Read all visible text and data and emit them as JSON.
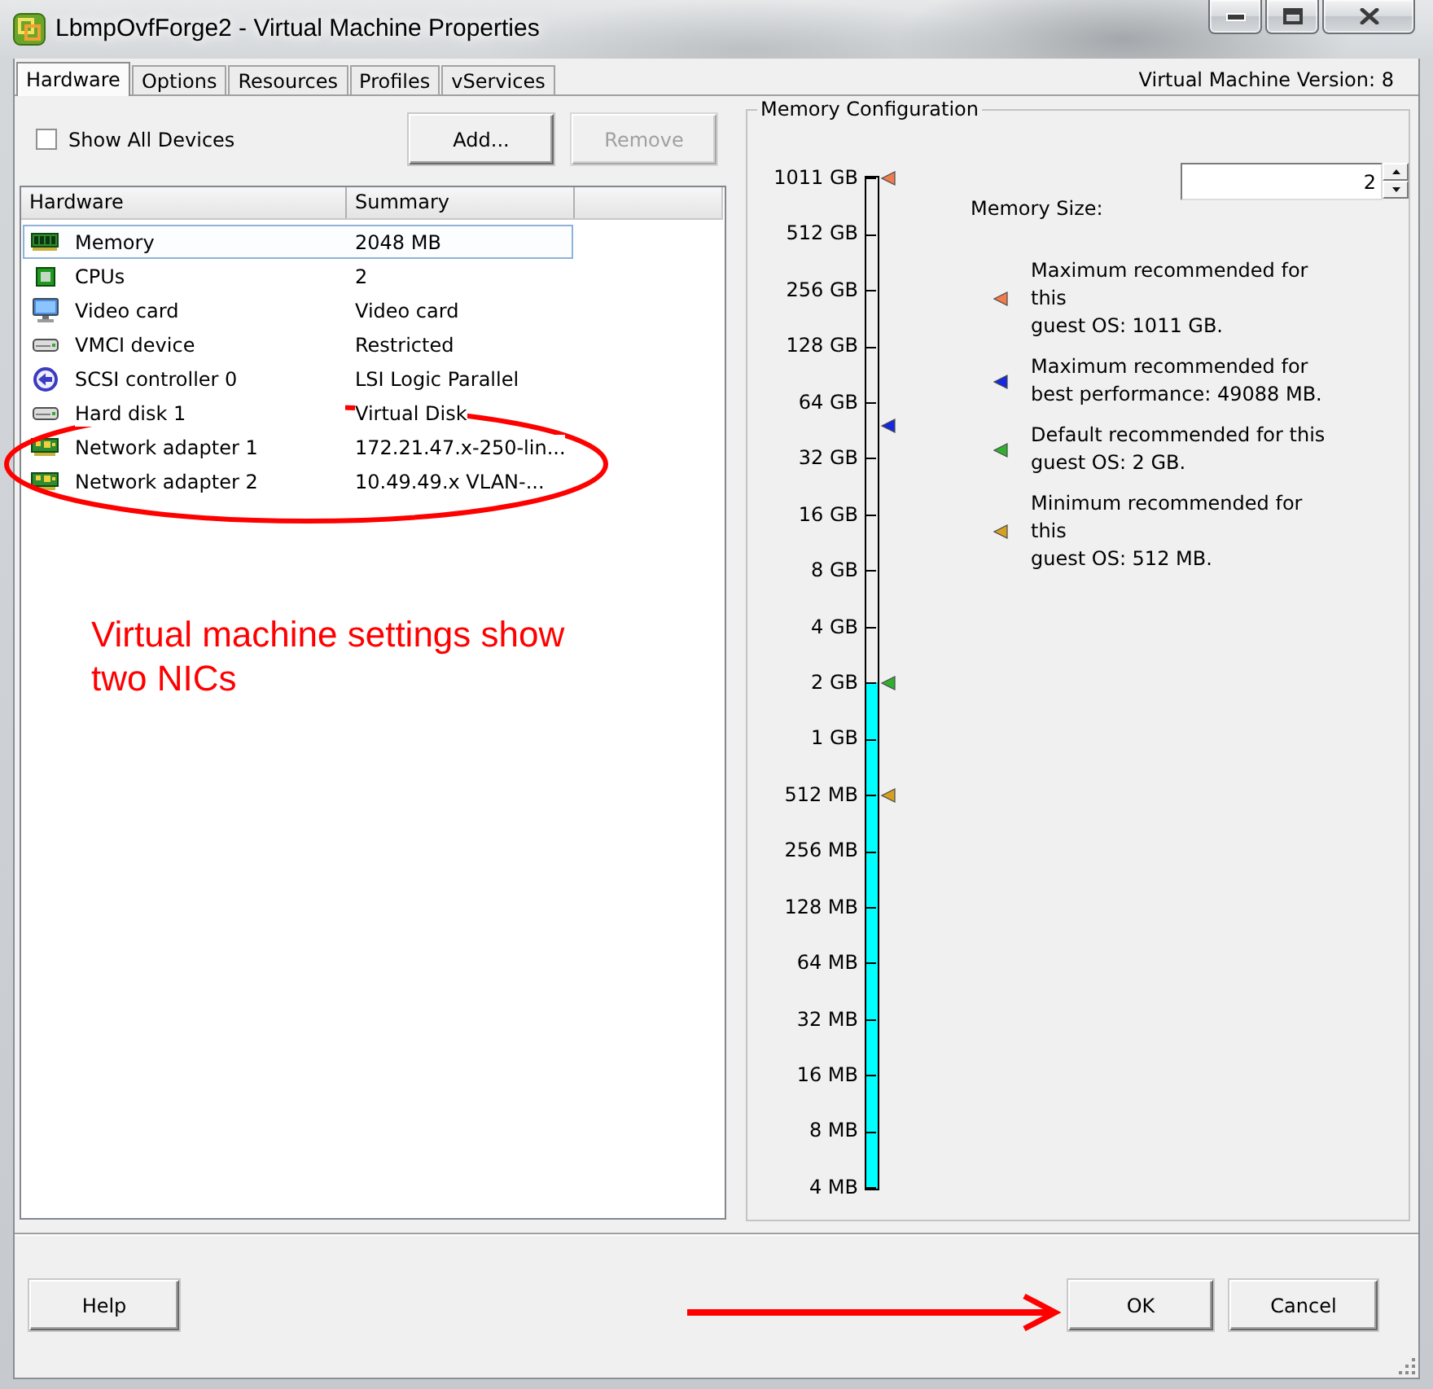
{
  "window": {
    "title": "LbmpOvfForge2 - Virtual Machine Properties"
  },
  "tabs": [
    {
      "label": "Hardware",
      "selected": true
    },
    {
      "label": "Options",
      "selected": false
    },
    {
      "label": "Resources",
      "selected": false
    },
    {
      "label": "Profiles",
      "selected": false
    },
    {
      "label": "vServices",
      "selected": false
    }
  ],
  "version": "Virtual Machine Version: 8",
  "hardware": {
    "show_all_devices": {
      "label": "Show All Devices",
      "checked": false
    },
    "buttons": [
      {
        "label": "Add...",
        "disabled": false
      },
      {
        "label": "Remove",
        "disabled": true
      }
    ],
    "table": {
      "columns": [
        "Hardware",
        "Summary"
      ],
      "rows": [
        {
          "kind": "memory",
          "name": "Memory",
          "summary": "2048 MB",
          "selected": true
        },
        {
          "kind": "cpu",
          "name": "CPUs",
          "summary": "2",
          "selected": false
        },
        {
          "kind": "video",
          "name": "Video card",
          "summary": "Video card",
          "selected": false
        },
        {
          "kind": "vmci",
          "name": "VMCI device",
          "summary": "Restricted",
          "selected": false
        },
        {
          "kind": "scsi",
          "name": "SCSI controller 0",
          "summary": "LSI Logic Parallel",
          "selected": false
        },
        {
          "kind": "disk",
          "name": "Hard disk 1",
          "summary": "Virtual Disk",
          "selected": false
        },
        {
          "kind": "network",
          "name": "Network adapter 1",
          "summary": "172.21.47.x-250-lin...",
          "selected": false
        },
        {
          "kind": "network",
          "name": "Network adapter 2",
          "summary": "10.49.49.x VLAN-...",
          "selected": false
        }
      ]
    }
  },
  "annotation": {
    "note": "Virtual machine settings show two NICs"
  },
  "memory_configuration": {
    "title": "Memory Configuration",
    "scale_labels": [
      "1011 GB",
      "512 GB",
      "256 GB",
      "128 GB",
      "64 GB",
      "32 GB",
      "16 GB",
      "8 GB",
      "4 GB",
      "2 GB",
      "1 GB",
      "512 MB",
      "256 MB",
      "128 MB",
      "64 MB",
      "32 MB",
      "16 MB",
      "8 MB",
      "4 MB"
    ],
    "slider": {
      "level": 0.5,
      "markers": [
        {
          "color": "#f27b4e",
          "level": 1
        },
        {
          "color": "#1428e0",
          "level": 0.754
        },
        {
          "color": "#2fb02f",
          "level": 0.5
        },
        {
          "color": "#d6a022",
          "level": 0.389
        }
      ]
    },
    "memory_size": {
      "label": "Memory Size:",
      "value": "2"
    },
    "legend": [
      {
        "color": "#f27b4e",
        "text": "Maximum recommended for\nthis\nguest OS: 1011 GB."
      },
      {
        "color": "#1428e0",
        "text": "Maximum recommended for\nbest performance: 49088 MB."
      },
      {
        "color": "#2fb02f",
        "text": "Default recommended for this\nguest OS: 2 GB."
      },
      {
        "color": "#d6a022",
        "text": "Minimum recommended for\nthis\nguest OS: 512 MB."
      }
    ]
  },
  "footer": {
    "help_button": "Help",
    "ok_button": "OK",
    "cancel_button": "Cancel"
  }
}
